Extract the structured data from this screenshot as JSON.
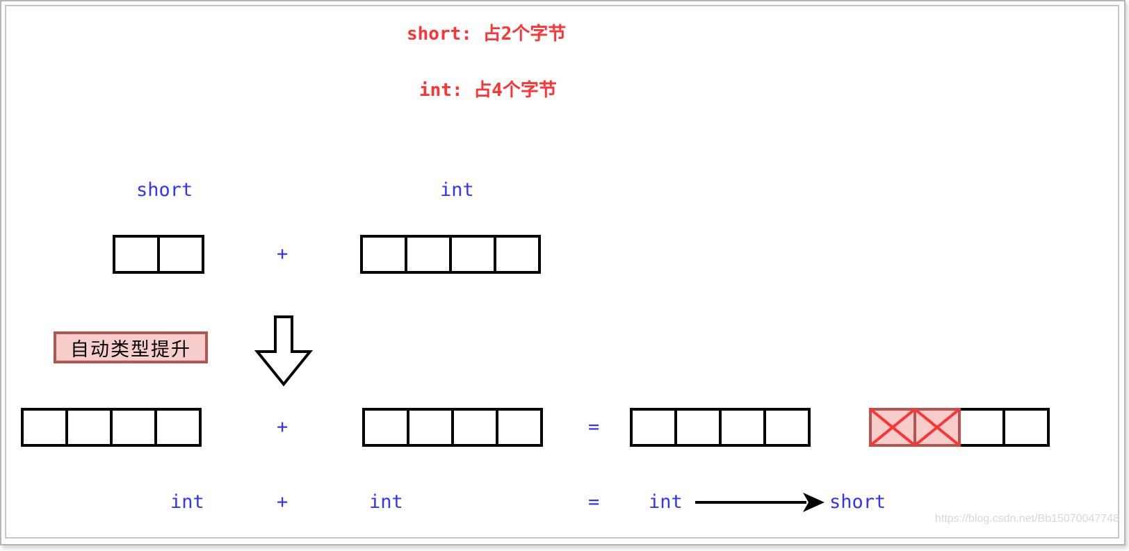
{
  "header": {
    "short_size_note": "short: 占2个字节",
    "int_size_note": "int: 占4个字节"
  },
  "operands": {
    "short_label": "short",
    "int_label": "int",
    "plus": "+",
    "short_bytes": 2,
    "int_bytes": 4
  },
  "promotion": {
    "label": "自动类型提升"
  },
  "promoted_row": {
    "plus": "+",
    "equals": "=",
    "left_bytes": 4,
    "right_bytes": 4,
    "result_bytes": 4,
    "cast_bytes": 4,
    "cast_discarded_bytes": 2
  },
  "type_row": {
    "left": "int",
    "plus": "+",
    "right": "int",
    "equals": "=",
    "result": "int",
    "cast_target": "short"
  },
  "colors": {
    "title_red": "#ff3333",
    "type_blue": "#3333ff",
    "highlight_fill": "#f8cecc",
    "highlight_border": "#b85450",
    "cross_red": "#ff3333"
  },
  "watermark": "https://blog.csdn.net/Bb15070047748"
}
